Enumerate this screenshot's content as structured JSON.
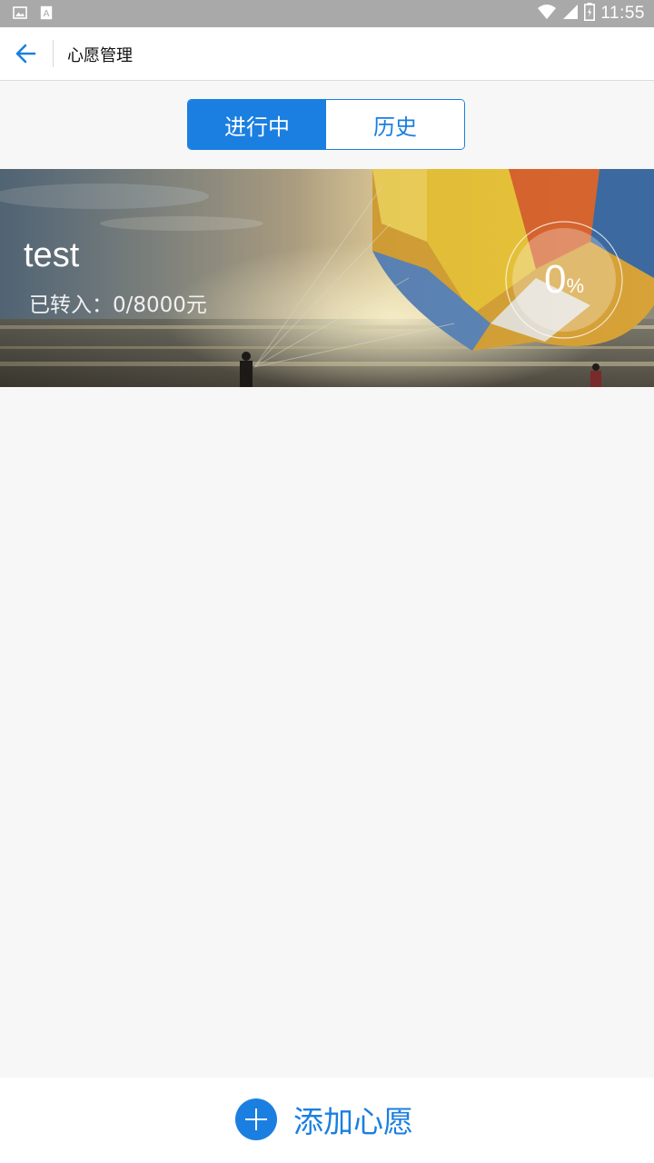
{
  "status_bar": {
    "time": "11:55",
    "icons": [
      "image-notification-icon",
      "text-a-notification-icon",
      "wifi-icon",
      "signal-icon",
      "battery-icon"
    ]
  },
  "header": {
    "title": "心愿管理",
    "back_icon": "arrow-left-icon"
  },
  "tabs": [
    {
      "label": "进行中",
      "active": true
    },
    {
      "label": "历史",
      "active": false
    }
  ],
  "wishes": [
    {
      "title": "test",
      "transferred_label": "已转入：0/8000元",
      "progress_value": "0",
      "progress_unit": "%",
      "progress_fraction": 0
    }
  ],
  "footer": {
    "add_label": "添加心愿",
    "add_icon": "plus-icon"
  },
  "colors": {
    "accent": "#1a7fe0",
    "background": "#f7f7f7",
    "status_bar": "#a9a9a9"
  }
}
